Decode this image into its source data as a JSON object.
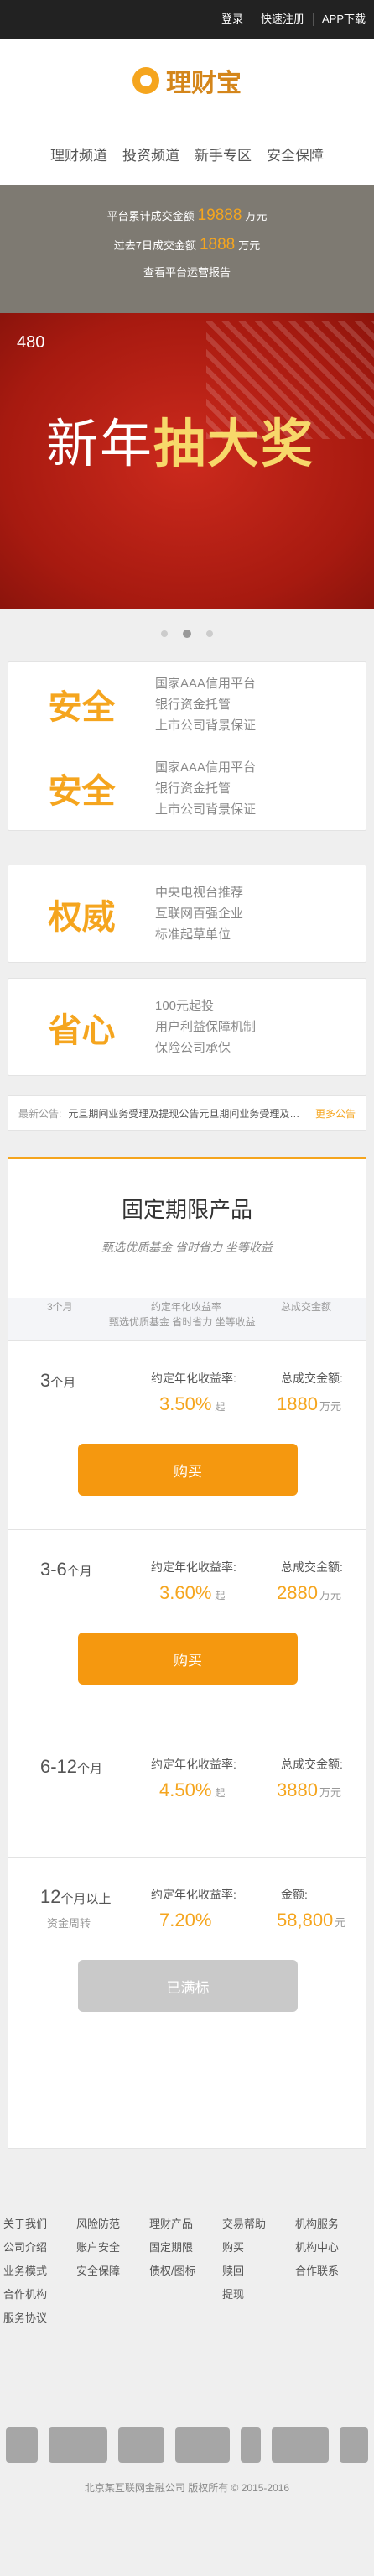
{
  "topbar": {
    "login": "登录",
    "register": "快速注册",
    "app": "APP下载"
  },
  "logo": {
    "text": "理财宝"
  },
  "nav": [
    "理财频道",
    "投资频道",
    "新手专区",
    "安全保障"
  ],
  "stats": {
    "total_prefix": "平台累计成交金额",
    "total_value": "19888",
    "total_unit": "万元",
    "week_prefix": "过去7日成交金额",
    "week_value": "1888",
    "week_unit": "万元",
    "report": "查看平台运营报告"
  },
  "banner": {
    "count": "480",
    "title_a": "新年",
    "title_b": "抽大奖"
  },
  "features": [
    {
      "title": "安全",
      "lines": [
        "国家AAA信用平台",
        "银行资金托管",
        "上市公司背景保证"
      ]
    },
    {
      "title": "安全",
      "lines": [
        "国家AAA信用平台",
        "银行资金托管",
        "上市公司背景保证"
      ]
    },
    {
      "title": "权威",
      "lines": [
        "中央电视台推荐",
        "互联网百强企业",
        "标准起草单位"
      ]
    },
    {
      "title": "省心",
      "lines": [
        "100元起投",
        "用户利益保障机制",
        "保险公司承保"
      ]
    }
  ],
  "notice": {
    "label": "最新公告:",
    "text": "元旦期间业务受理及提现公告元旦期间业务受理及提现公告",
    "more": "更多公告"
  },
  "products_head": {
    "title": "固定期限产品",
    "subtitle": "甄选优质基金 省时省力 坐等收益"
  },
  "ghost": {
    "term": "3个月",
    "rate": "约定年化收益率",
    "amt": "总成交金额",
    "sub": "甄选优质基金 省时省力 坐等收益"
  },
  "products": [
    {
      "term": "3",
      "term_unit": "个月",
      "sub": "",
      "rate_label": "约定年化收益率:",
      "rate": "3.50%",
      "rate_suffix": "起",
      "amt_label": "总成交金额:",
      "amt": "1880",
      "amt_unit": "万元",
      "button": "购买"
    },
    {
      "term": "3-6",
      "term_unit": "个月",
      "sub": "",
      "rate_label": "约定年化收益率:",
      "rate": "3.60%",
      "rate_suffix": "起",
      "amt_label": "总成交金额:",
      "amt": "2880",
      "amt_unit": "万元",
      "button": "购买"
    },
    {
      "term": "6-12",
      "term_unit": "个月",
      "sub": "",
      "rate_label": "约定年化收益率:",
      "rate": "4.50%",
      "rate_suffix": "起",
      "amt_label": "总成交金额:",
      "amt": "3880",
      "amt_unit": "万元",
      "button": ""
    },
    {
      "term": "12",
      "term_unit": "个月以上",
      "sub": "资金周转",
      "rate_label": "约定年化收益率:",
      "rate": "7.20%",
      "rate_suffix": "",
      "amt_label": "金额:",
      "amt": "58,800",
      "amt_unit": "元",
      "button": "已满标"
    }
  ],
  "footer_links": [
    [
      "关于我们",
      "公司介绍",
      "业务模式",
      "合作机构",
      "服务协议"
    ],
    [
      "风险防范",
      "账户安全",
      "安全保障"
    ],
    [
      "理财产品",
      "固定期限",
      "债权/图标"
    ],
    [
      "交易帮助",
      "购买",
      "赎回",
      "提现"
    ],
    [
      "机构服务",
      "机构中心",
      "合作联系"
    ]
  ],
  "copyright": "北京某互联网金融公司 版权所有 © 2015-2016"
}
